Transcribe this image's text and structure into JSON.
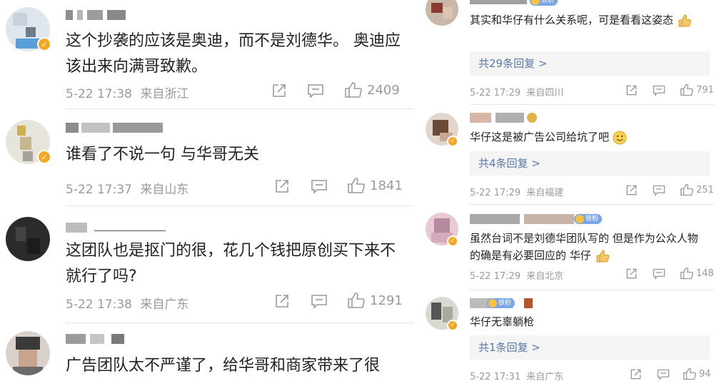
{
  "left_comments": [
    {
      "text": "这个抄袭的应该是奥迪，而不是刘德华。 奥迪应该出来向满哥致歉。",
      "time": "5-22 17:38",
      "location": "来自浙江",
      "likes": "2409"
    },
    {
      "text": "谁看了不说一句 与华哥无关",
      "time": "5-22 17:37",
      "location": "来自山东",
      "likes": "1841"
    },
    {
      "text": "这团队也是抠门的很，花几个钱把原创买下来不就行了吗?",
      "time": "5-22 17:38",
      "location": "来自广东",
      "likes": "1291"
    },
    {
      "text": "广告团队太不严谨了，给华哥和商家带来了很"
    }
  ],
  "right_comments": [
    {
      "text": "其实和华仔有什么关系呢，可是看看这姿态",
      "emoji": "thumbs-up",
      "replies": "共29条回复 >",
      "time": "5-22 17:29",
      "location": "来自四川",
      "likes": "791",
      "badge": "铁粉"
    },
    {
      "text": "华仔这是被广告公司给坑了吧",
      "emoji": "smile",
      "replies": "共4条回复 >",
      "time": "5-22 17:29",
      "location": "来自福建",
      "likes": "251"
    },
    {
      "text": "虽然台词不是刘德华团队写的 但是作为公众人物 的确是有必要回应的 华仔",
      "emoji": "thumbs-up",
      "time": "5-22 17:29",
      "location": "来自北京",
      "likes": "148",
      "badge": "铁粉"
    },
    {
      "text": "华仔无辜躺枪",
      "replies": "共1条回复 >",
      "time": "5-22 17:31",
      "location": "来自广东",
      "likes": "94",
      "badge": "铁粉"
    }
  ],
  "colors": {
    "meta": "#9a9a9a",
    "reply_link": "#5a78a8",
    "reply_bg": "#f4f4f4",
    "verify_badge": "#f5a623",
    "fan_badge": "#7aa6e8"
  },
  "icons": [
    "share-icon",
    "comment-icon",
    "like-icon",
    "verified-badge-icon",
    "thumbs-up-emoji",
    "smile-emoji"
  ]
}
